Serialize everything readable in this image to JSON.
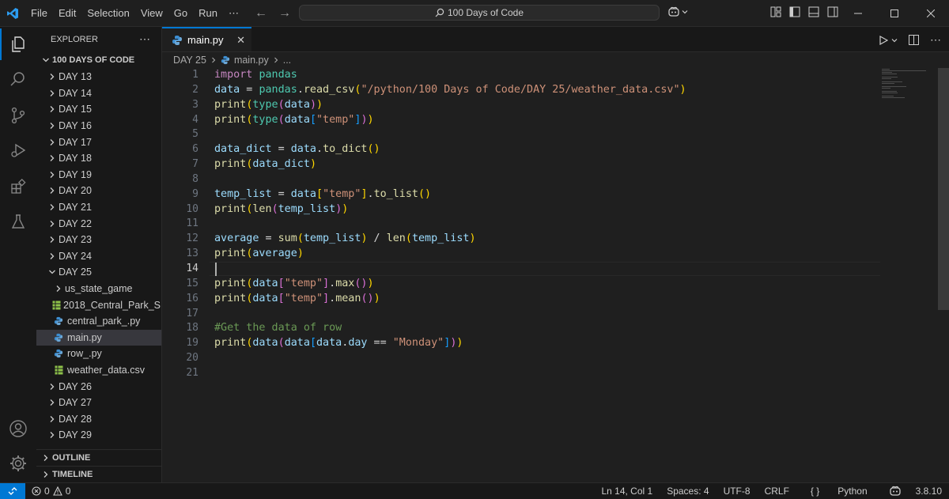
{
  "titlebar": {
    "menu": [
      "File",
      "Edit",
      "Selection",
      "View",
      "Go",
      "Run",
      "⋯"
    ],
    "search_text": "100 Days of Code"
  },
  "sidebar": {
    "title": "EXPLORER",
    "folder": "100 DAYS OF CODE",
    "items": [
      {
        "label": "DAY 13",
        "type": "folder",
        "expanded": false,
        "indent": 1
      },
      {
        "label": "DAY 14",
        "type": "folder",
        "expanded": false,
        "indent": 1
      },
      {
        "label": "DAY 15",
        "type": "folder",
        "expanded": false,
        "indent": 1
      },
      {
        "label": "DAY 16",
        "type": "folder",
        "expanded": false,
        "indent": 1
      },
      {
        "label": "DAY 17",
        "type": "folder",
        "expanded": false,
        "indent": 1
      },
      {
        "label": "DAY 18",
        "type": "folder",
        "expanded": false,
        "indent": 1
      },
      {
        "label": "DAY 19",
        "type": "folder",
        "expanded": false,
        "indent": 1
      },
      {
        "label": "DAY 20",
        "type": "folder",
        "expanded": false,
        "indent": 1
      },
      {
        "label": "DAY 21",
        "type": "folder",
        "expanded": false,
        "indent": 1
      },
      {
        "label": "DAY 22",
        "type": "folder",
        "expanded": false,
        "indent": 1
      },
      {
        "label": "DAY 23",
        "type": "folder",
        "expanded": false,
        "indent": 1
      },
      {
        "label": "DAY 24",
        "type": "folder",
        "expanded": false,
        "indent": 1
      },
      {
        "label": "DAY 25",
        "type": "folder",
        "expanded": true,
        "indent": 1
      },
      {
        "label": "us_state_game",
        "type": "folder",
        "expanded": false,
        "indent": 2
      },
      {
        "label": "2018_Central_Park_S...",
        "type": "csv",
        "indent": 2
      },
      {
        "label": "central_park_.py",
        "type": "py",
        "indent": 2
      },
      {
        "label": "main.py",
        "type": "py",
        "indent": 2,
        "selected": true
      },
      {
        "label": "row_.py",
        "type": "py",
        "indent": 2
      },
      {
        "label": "weather_data.csv",
        "type": "csv",
        "indent": 2
      },
      {
        "label": "DAY 26",
        "type": "folder",
        "expanded": false,
        "indent": 1
      },
      {
        "label": "DAY 27",
        "type": "folder",
        "expanded": false,
        "indent": 1
      },
      {
        "label": "DAY 28",
        "type": "folder",
        "expanded": false,
        "indent": 1
      },
      {
        "label": "DAY 29",
        "type": "folder",
        "expanded": false,
        "indent": 1
      }
    ],
    "outline": "OUTLINE",
    "timeline": "TIMELINE"
  },
  "tab": {
    "label": "main.py"
  },
  "breadcrumb": {
    "folder": "DAY 25",
    "file": "main.py",
    "more": "..."
  },
  "editor": {
    "active_line": 14,
    "lines": [
      [
        [
          "kw",
          "import"
        ],
        [
          "",
          " "
        ],
        [
          "mod",
          "pandas"
        ]
      ],
      [
        [
          "var",
          "data"
        ],
        [
          "op",
          " = "
        ],
        [
          "mod",
          "pandas"
        ],
        [
          "op",
          "."
        ],
        [
          "fn",
          "read_csv"
        ],
        [
          "b1",
          "("
        ],
        [
          "str",
          "\"/python/100 Days of Code/DAY 25/weather_data.csv\""
        ],
        [
          "b1",
          ")"
        ]
      ],
      [
        [
          "fn",
          "print"
        ],
        [
          "b1",
          "("
        ],
        [
          "mod",
          "type"
        ],
        [
          "b2",
          "("
        ],
        [
          "var",
          "data"
        ],
        [
          "b2",
          ")"
        ],
        [
          "b1",
          ")"
        ]
      ],
      [
        [
          "fn",
          "print"
        ],
        [
          "b1",
          "("
        ],
        [
          "mod",
          "type"
        ],
        [
          "b2",
          "("
        ],
        [
          "var",
          "data"
        ],
        [
          "b3",
          "["
        ],
        [
          "str",
          "\"temp\""
        ],
        [
          "b3",
          "]"
        ],
        [
          "b2",
          ")"
        ],
        [
          "b1",
          ")"
        ]
      ],
      [],
      [
        [
          "var",
          "data_dict"
        ],
        [
          "op",
          " = "
        ],
        [
          "var",
          "data"
        ],
        [
          "op",
          "."
        ],
        [
          "fn",
          "to_dict"
        ],
        [
          "b1",
          "()"
        ]
      ],
      [
        [
          "fn",
          "print"
        ],
        [
          "b1",
          "("
        ],
        [
          "var",
          "data_dict"
        ],
        [
          "b1",
          ")"
        ]
      ],
      [],
      [
        [
          "var",
          "temp_list"
        ],
        [
          "op",
          " = "
        ],
        [
          "var",
          "data"
        ],
        [
          "b1",
          "["
        ],
        [
          "str",
          "\"temp\""
        ],
        [
          "b1",
          "]"
        ],
        [
          "op",
          "."
        ],
        [
          "fn",
          "to_list"
        ],
        [
          "b1",
          "()"
        ]
      ],
      [
        [
          "fn",
          "print"
        ],
        [
          "b1",
          "("
        ],
        [
          "fn",
          "len"
        ],
        [
          "b2",
          "("
        ],
        [
          "var",
          "temp_list"
        ],
        [
          "b2",
          ")"
        ],
        [
          "b1",
          ")"
        ]
      ],
      [],
      [
        [
          "var",
          "average"
        ],
        [
          "op",
          " = "
        ],
        [
          "fn",
          "sum"
        ],
        [
          "b1",
          "("
        ],
        [
          "var",
          "temp_list"
        ],
        [
          "b1",
          ")"
        ],
        [
          "op",
          " / "
        ],
        [
          "fn",
          "len"
        ],
        [
          "b1",
          "("
        ],
        [
          "var",
          "temp_list"
        ],
        [
          "b1",
          ")"
        ]
      ],
      [
        [
          "fn",
          "print"
        ],
        [
          "b1",
          "("
        ],
        [
          "var",
          "average"
        ],
        [
          "b1",
          ")"
        ]
      ],
      [],
      [
        [
          "fn",
          "print"
        ],
        [
          "b1",
          "("
        ],
        [
          "var",
          "data"
        ],
        [
          "b2",
          "["
        ],
        [
          "str",
          "\"temp\""
        ],
        [
          "b2",
          "]"
        ],
        [
          "op",
          "."
        ],
        [
          "fn",
          "max"
        ],
        [
          "b2",
          "()"
        ],
        [
          "b1",
          ")"
        ]
      ],
      [
        [
          "fn",
          "print"
        ],
        [
          "b1",
          "("
        ],
        [
          "var",
          "data"
        ],
        [
          "b2",
          "["
        ],
        [
          "str",
          "\"temp\""
        ],
        [
          "b2",
          "]"
        ],
        [
          "op",
          "."
        ],
        [
          "fn",
          "mean"
        ],
        [
          "b2",
          "()"
        ],
        [
          "b1",
          ")"
        ]
      ],
      [],
      [
        [
          "cm",
          "#Get the data of row"
        ]
      ],
      [
        [
          "fn",
          "print"
        ],
        [
          "b1",
          "("
        ],
        [
          "var",
          "data"
        ],
        [
          "b2",
          "("
        ],
        [
          "var",
          "data"
        ],
        [
          "b3",
          "["
        ],
        [
          "var",
          "data"
        ],
        [
          "op",
          "."
        ],
        [
          "var",
          "day"
        ],
        [
          "op",
          " == "
        ],
        [
          "str",
          "\"Monday\""
        ],
        [
          "b3",
          "]"
        ],
        [
          "b2",
          ")"
        ],
        [
          "b1",
          ")"
        ]
      ],
      [],
      []
    ]
  },
  "statusbar": {
    "errors": "0",
    "warnings": "0",
    "position": "Ln 14, Col 1",
    "spaces": "Spaces: 4",
    "encoding": "UTF-8",
    "eol": "CRLF",
    "language": "Python",
    "python_version": "3.8.10"
  },
  "colors": {
    "accent": "#0078d4",
    "bg": "#1f1f1f",
    "sidebar_bg": "#181818"
  }
}
